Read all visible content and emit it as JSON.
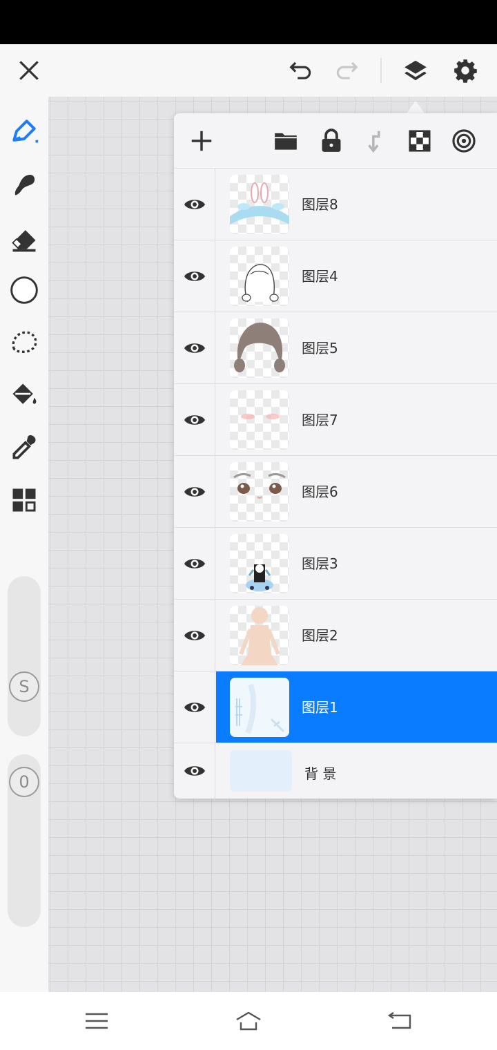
{
  "colors": {
    "accent": "#0a7cff",
    "panel_bg": "#f4f4f6",
    "toolbar_bg": "#f7f7f7",
    "canvas_bg": "#e3e3e6"
  },
  "top_bar": {
    "icons": [
      "close-icon",
      "undo-icon",
      "redo-icon",
      "layers-icon",
      "gear-icon"
    ]
  },
  "tools": [
    "brush-icon",
    "smudge-icon",
    "eraser-icon",
    "circle-brush-icon",
    "lasso-icon",
    "bucket-icon",
    "eyedropper-icon",
    "grid-icon"
  ],
  "sliders": {
    "size_label": "S",
    "opacity_label": "0"
  },
  "layers_panel": {
    "toolbar_icons": [
      "add-icon",
      "folder-icon",
      "lock-icon",
      "merge-down-icon",
      "checker-icon",
      "blend-icon"
    ],
    "layers": [
      {
        "name": "图层8",
        "visible": true,
        "selected": false
      },
      {
        "name": "图层4",
        "visible": true,
        "selected": false
      },
      {
        "name": "图层5",
        "visible": true,
        "selected": false
      },
      {
        "name": "图层7",
        "visible": true,
        "selected": false
      },
      {
        "name": "图层6",
        "visible": true,
        "selected": false
      },
      {
        "name": "图层3",
        "visible": true,
        "selected": false
      },
      {
        "name": "图层2",
        "visible": true,
        "selected": false
      },
      {
        "name": "图层1",
        "visible": true,
        "selected": true
      },
      {
        "name": "背 景",
        "visible": true,
        "selected": false
      }
    ]
  },
  "nav_bar": {
    "icons": [
      "menu-icon",
      "home-icon",
      "back-icon"
    ]
  }
}
